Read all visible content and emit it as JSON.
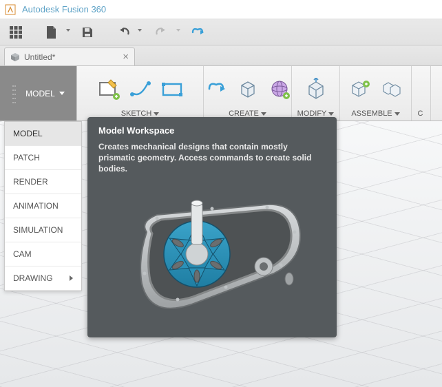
{
  "app": {
    "title": "Autodesk Fusion 360"
  },
  "tab": {
    "name": "Untitled*"
  },
  "workspace": {
    "current": "MODEL"
  },
  "ribbon": {
    "sketch": {
      "label": "SKETCH"
    },
    "create": {
      "label": "CREATE"
    },
    "modify": {
      "label": "MODIFY"
    },
    "assemble": {
      "label": "ASSEMBLE"
    },
    "construct": {
      "label": "C"
    }
  },
  "ws_menu": {
    "items": [
      {
        "label": "MODEL",
        "active": true,
        "submenu": false
      },
      {
        "label": "PATCH",
        "active": false,
        "submenu": false
      },
      {
        "label": "RENDER",
        "active": false,
        "submenu": false
      },
      {
        "label": "ANIMATION",
        "active": false,
        "submenu": false
      },
      {
        "label": "SIMULATION",
        "active": false,
        "submenu": false
      },
      {
        "label": "CAM",
        "active": false,
        "submenu": false
      },
      {
        "label": "DRAWING",
        "active": false,
        "submenu": true
      }
    ]
  },
  "tooltip": {
    "title": "Model Workspace",
    "body": "Creates mechanical designs that contain mostly prismatic geometry. Access commands to create solid bodies."
  }
}
